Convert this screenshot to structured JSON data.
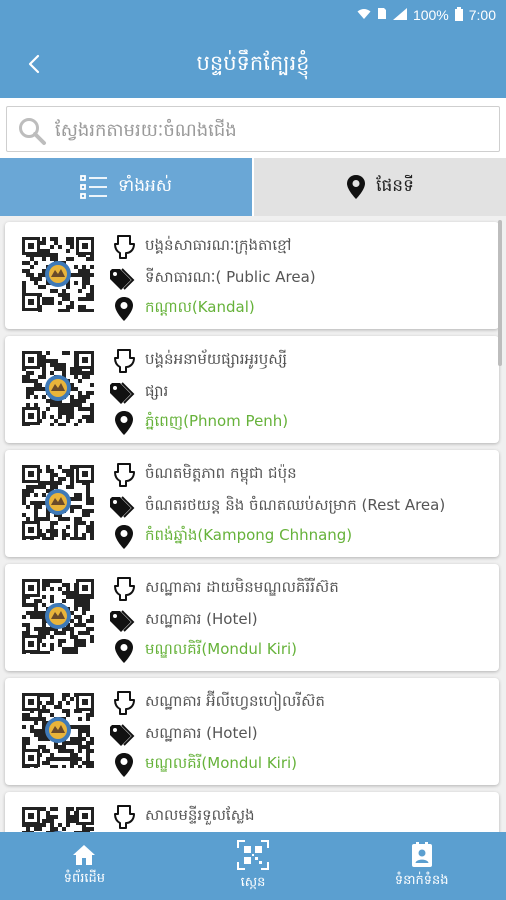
{
  "status": {
    "battery": "100%",
    "time": "7:00"
  },
  "header": {
    "title": "បន្ទប់ទឹកក្បែរខ្ញុំ"
  },
  "search": {
    "placeholder": "ស្វែងរកតាមរយៈចំណងជើង"
  },
  "tabs": [
    {
      "label": "ទាំងអស់",
      "icon": "list-icon"
    },
    {
      "label": "ផែនទី",
      "icon": "map-pin-icon"
    }
  ],
  "items": [
    {
      "name": "បង្គន់សាធារណៈក្រុងតាខ្មៅ",
      "category": "ទីសាធារណៈ( Public Area)",
      "location": "កណ្តាល(Kandal)"
    },
    {
      "name": "បង្គន់អនាម័យផ្សារអូរឫស្សី",
      "category": "ផ្សារ",
      "location": "ភ្នំពេញ(Phnom Penh)"
    },
    {
      "name": "ចំណតមិត្តភាព កម្ពុជា ជប៉ុន",
      "category": "ចំណតរថយន្ត និង ចំណតឈប់សម្រាក (Rest Area)",
      "location": "កំពង់ឆ្នាំង(Kampong Chhnang)"
    },
    {
      "name": "សណ្ឋាគារ ដាយមិនមណ្ឌលគិរីរីស៊ត",
      "category": "សណ្ឋាគារ (Hotel)",
      "location": "មណ្ឌលគិរី(Mondul Kiri)"
    },
    {
      "name": "សណ្ឋាគារ អ៊ីលីហ្វេនហៀលរីស៊ត",
      "category": "សណ្ឋាគារ (Hotel)",
      "location": "មណ្ឌលគិរី(Mondul Kiri)"
    },
    {
      "name": "សាលមន្ទីរទួលស្លែង",
      "category": "",
      "location": ""
    }
  ],
  "bottom_nav": [
    {
      "label": "ទំព័រដើម",
      "icon": "home-icon"
    },
    {
      "label": "ស្កេន",
      "icon": "qr-scan-icon"
    },
    {
      "label": "ទំនាក់ទំនង",
      "icon": "contact-icon"
    }
  ],
  "colors": {
    "primary": "#5b9fd0",
    "tab_active": "#6aa7d6",
    "location_text": "#66b23a"
  }
}
